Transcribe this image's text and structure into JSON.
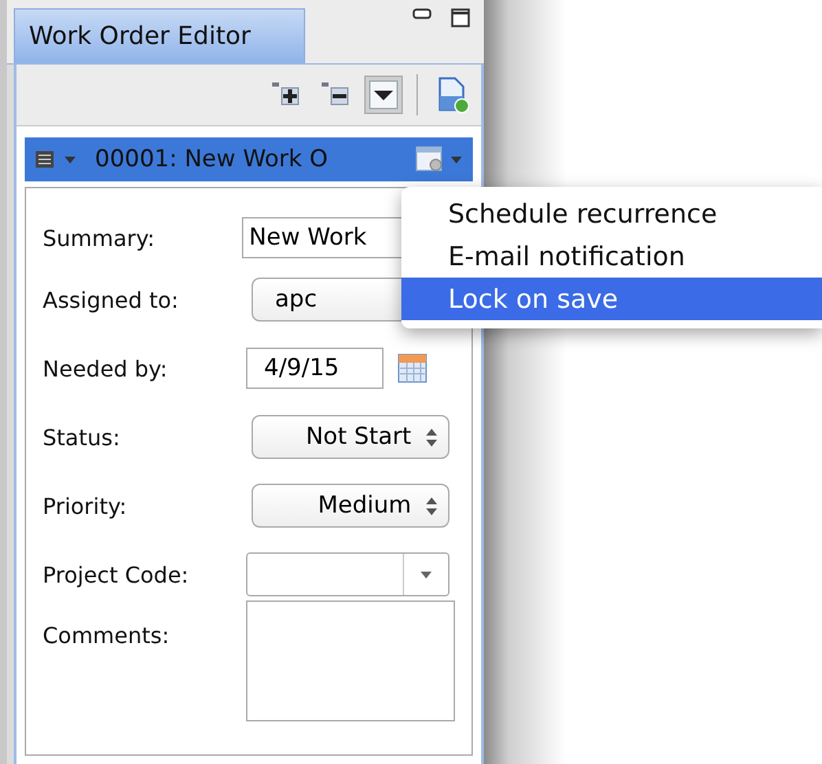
{
  "window": {
    "title": "Work Order Editor"
  },
  "toolbar": [
    {
      "kind": "expand",
      "selected": false
    },
    {
      "kind": "collapse",
      "selected": false
    },
    {
      "kind": "dropdown",
      "selected": true
    },
    {
      "kind": "new",
      "selected": false
    }
  ],
  "header": {
    "title": "00001: New Work O"
  },
  "fields": [
    {
      "kind": "text",
      "label": "Summary:",
      "value": "New Work"
    },
    {
      "kind": "combo",
      "label": "Assigned to:",
      "value": "apc"
    },
    {
      "kind": "date",
      "label": "Needed by:",
      "value": "4/9/15"
    },
    {
      "kind": "popup",
      "label": "Status:",
      "value": "Not Start"
    },
    {
      "kind": "popup",
      "label": "Priority:",
      "value": "Medium"
    },
    {
      "kind": "dropdown",
      "label": "Project Code:"
    },
    {
      "kind": "textarea",
      "label": "Comments:"
    }
  ],
  "menu": [
    {
      "label": "Schedule recurrence",
      "selected": false
    },
    {
      "label": "E-mail notification",
      "selected": false
    },
    {
      "label": "Lock on save",
      "selected": true
    }
  ]
}
